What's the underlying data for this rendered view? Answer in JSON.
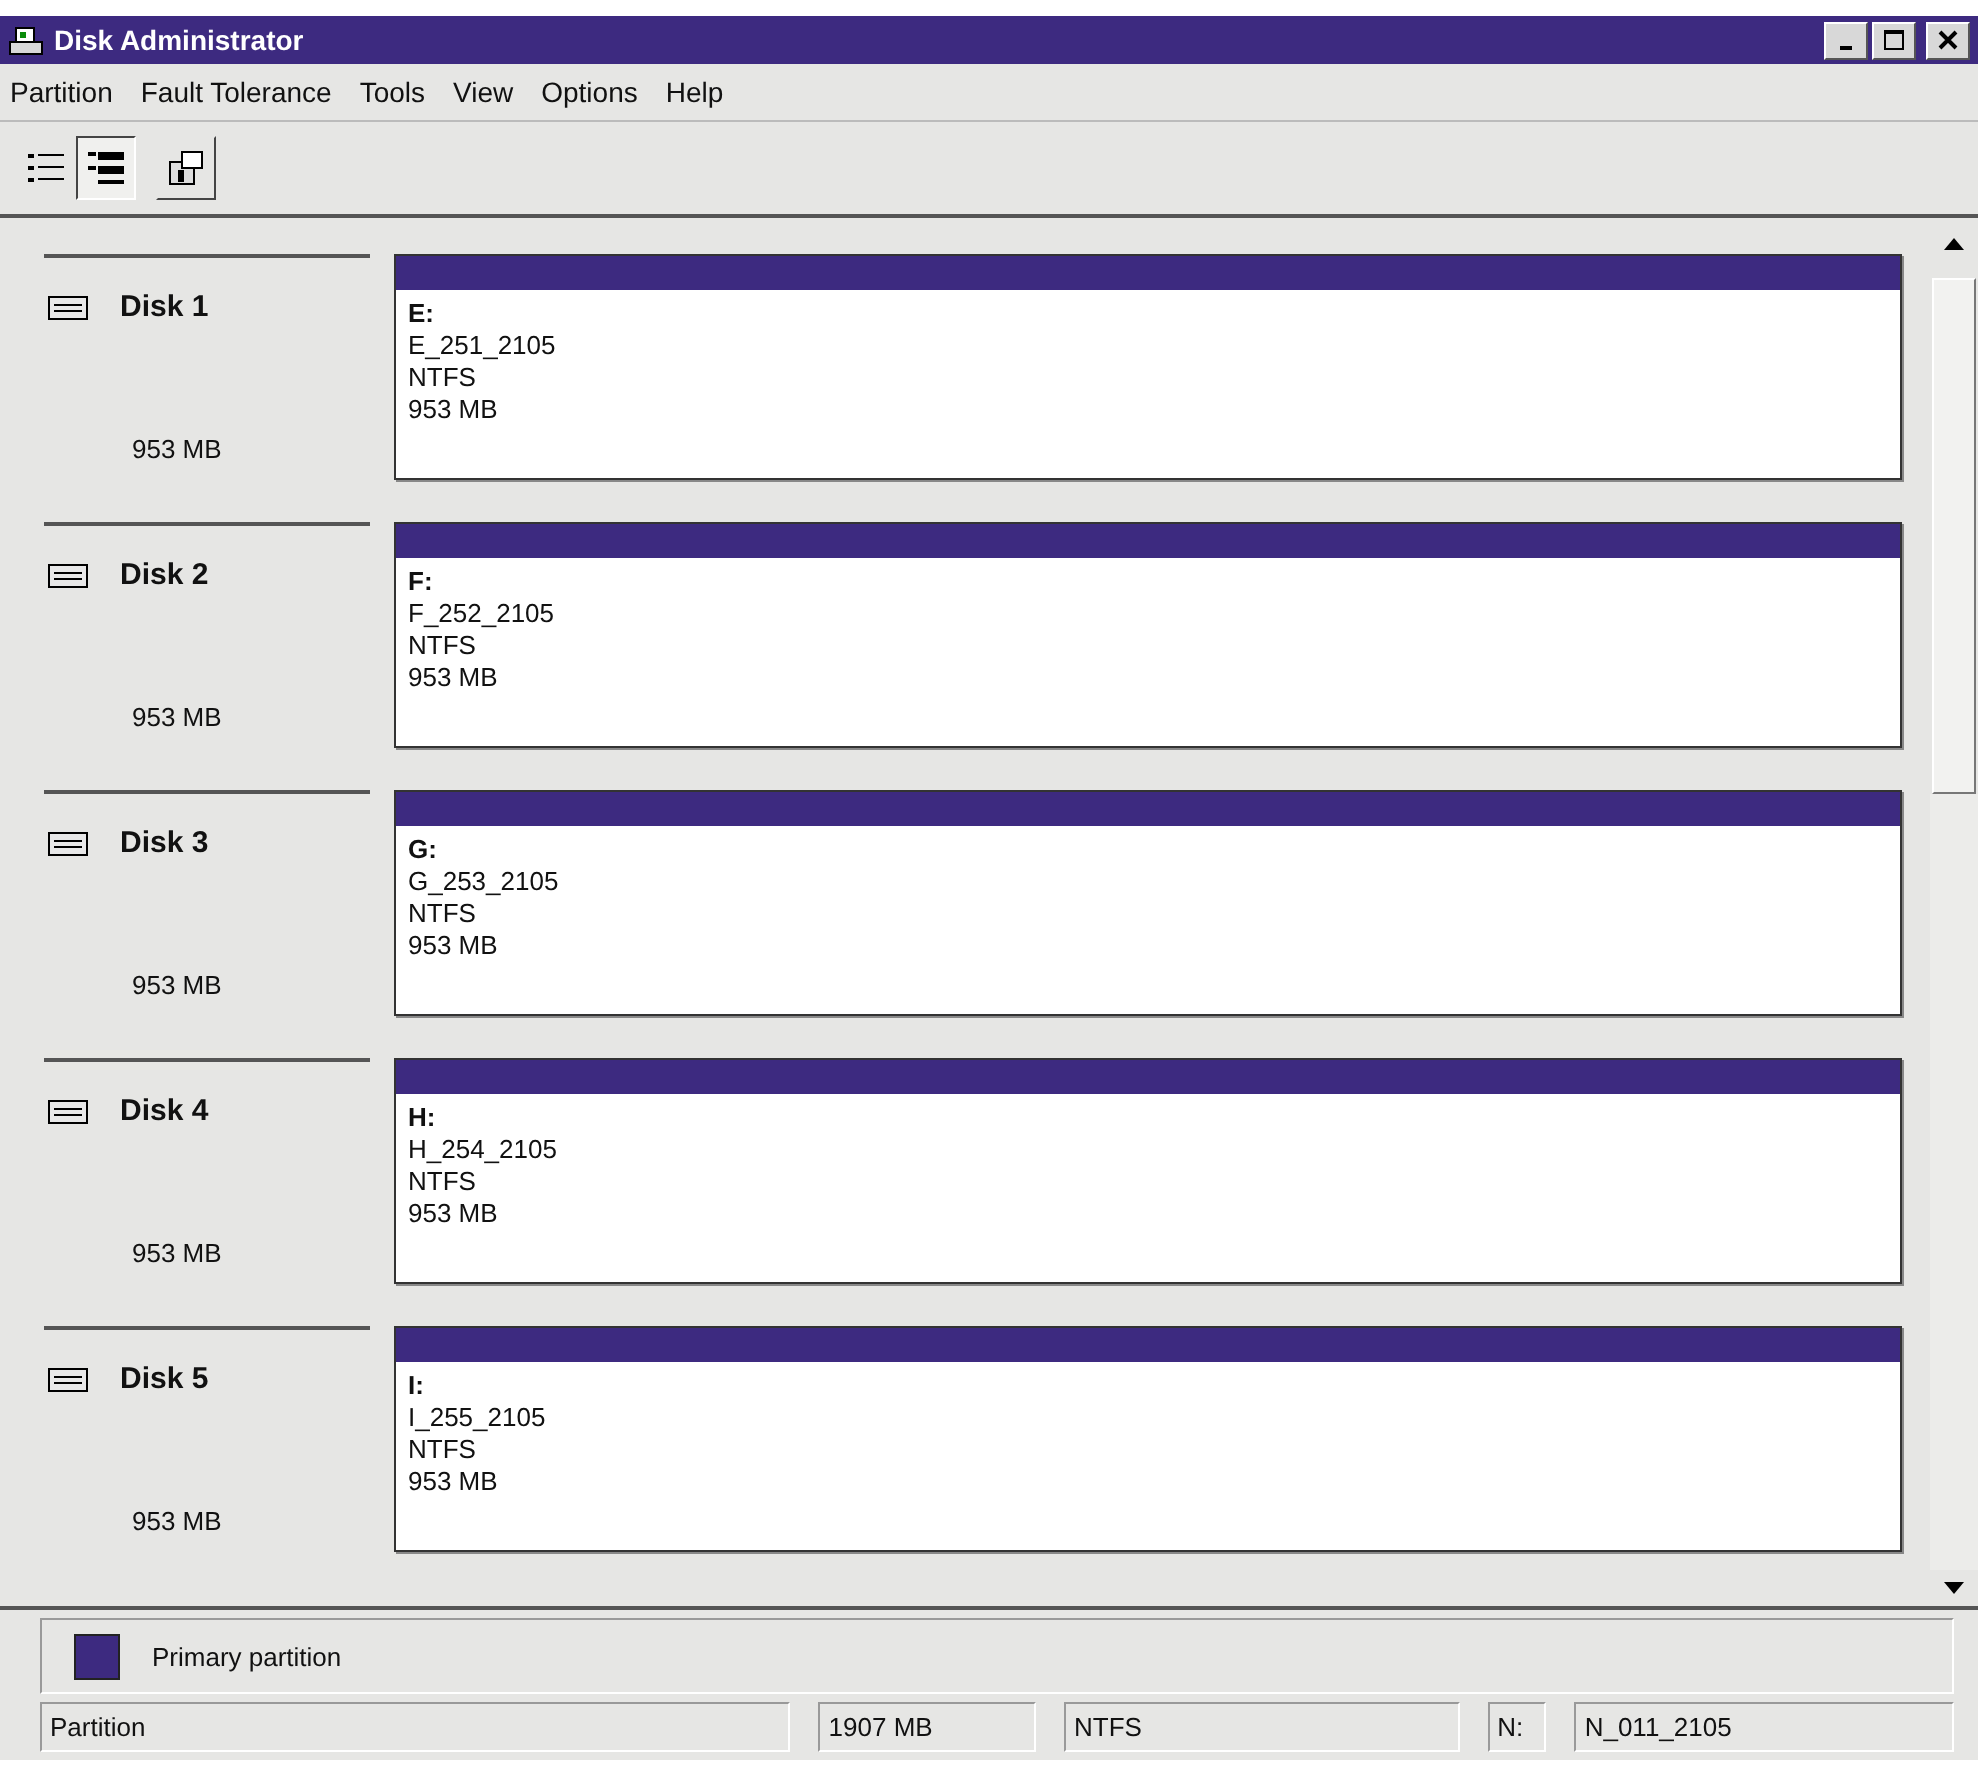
{
  "window": {
    "title": "Disk Administrator"
  },
  "menu": [
    "Partition",
    "Fault Tolerance",
    "Tools",
    "View",
    "Options",
    "Help"
  ],
  "toolbar": [
    {
      "kind": "volumes",
      "selected": false
    },
    {
      "kind": "disks",
      "selected": true
    },
    {
      "kind": "properties",
      "selected": false
    }
  ],
  "disks": [
    {
      "name": "Disk 1",
      "size": "953 MB",
      "partition": {
        "color": "#3d2a80",
        "letter": "E:",
        "label": "E_251_2105",
        "filesystem": "NTFS",
        "size": "953 MB"
      }
    },
    {
      "name": "Disk 2",
      "size": "953 MB",
      "partition": {
        "color": "#3d2a80",
        "letter": "F:",
        "label": "F_252_2105",
        "filesystem": "NTFS",
        "size": "953 MB"
      }
    },
    {
      "name": "Disk 3",
      "size": "953 MB",
      "partition": {
        "color": "#3d2a80",
        "letter": "G:",
        "label": "G_253_2105",
        "filesystem": "NTFS",
        "size": "953 MB"
      }
    },
    {
      "name": "Disk 4",
      "size": "953 MB",
      "partition": {
        "color": "#3d2a80",
        "letter": "H:",
        "label": "H_254_2105",
        "filesystem": "NTFS",
        "size": "953 MB"
      }
    },
    {
      "name": "Disk 5",
      "size": "953 MB",
      "partition": {
        "color": "#3d2a80",
        "letter": "I:",
        "label": "I_255_2105",
        "filesystem": "NTFS",
        "size": "953 MB"
      }
    }
  ],
  "legend": [
    {
      "label": "Primary partition",
      "color": "#3d2a80"
    }
  ],
  "status_bar": [
    "Partition",
    "1907 MB",
    "NTFS",
    "N:",
    "N_011_2105"
  ]
}
